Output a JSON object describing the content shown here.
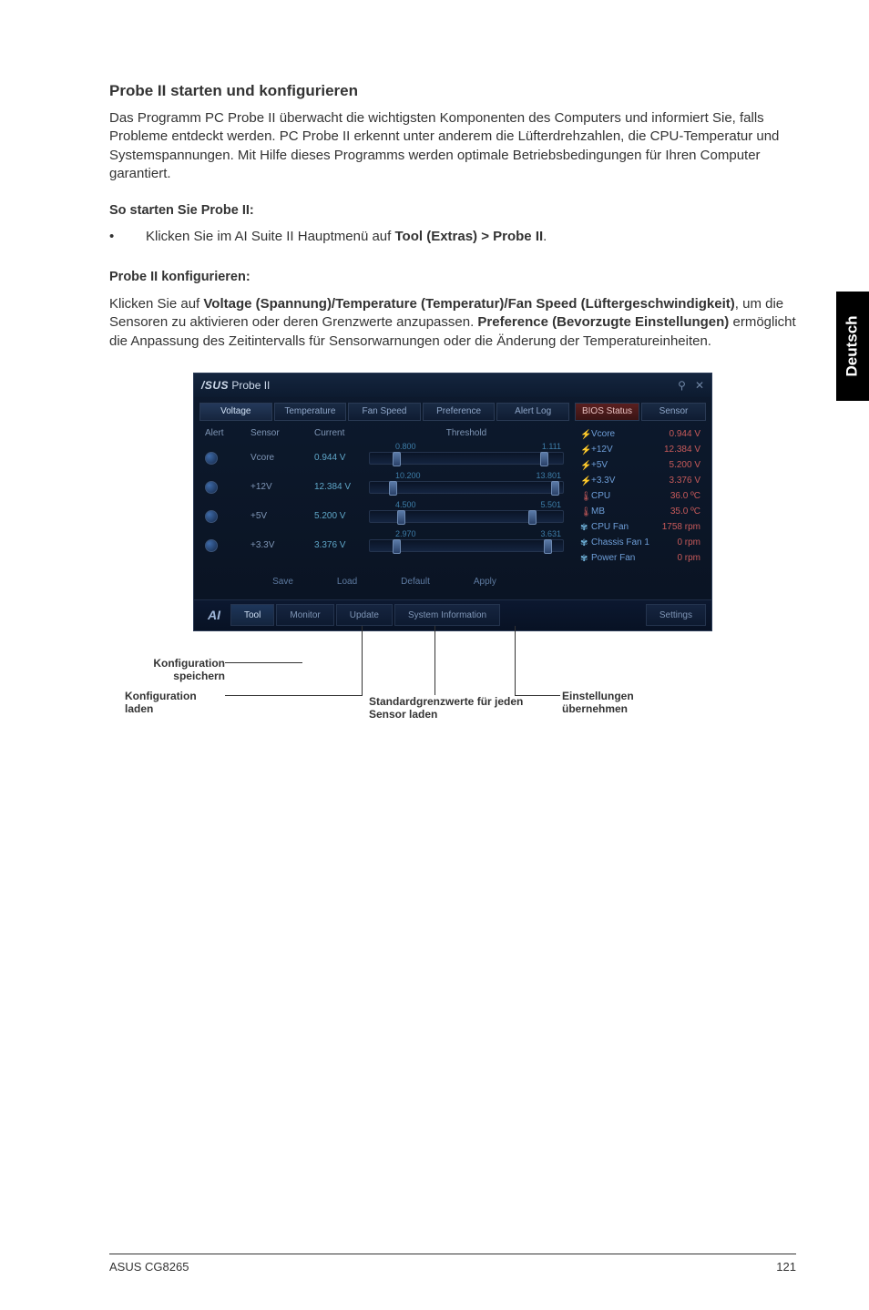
{
  "doc": {
    "heading": "Probe II starten und konfigurieren",
    "intro": "Das Programm PC Probe II überwacht die wichtigsten Komponenten des Computers und informiert Sie, falls Probleme entdeckt werden. PC Probe II erkennt unter anderem die Lüfterdrehzahlen, die CPU-Temperatur und Systemspannungen. Mit Hilfe dieses Programms werden optimale Betriebsbedingungen für Ihren Computer garantiert.",
    "start_head": "So starten Sie Probe II:",
    "bullet_pre": "Klicken Sie im AI Suite II Hauptmenü auf ",
    "bullet_bold": "Tool (Extras) > Probe II",
    "bullet_post": ".",
    "config_head": "Probe II konfigurieren:",
    "config_p1_pre": "Klicken Sie auf ",
    "config_p1_b1": "Voltage (Spannung)/Temperature (Temperatur)/Fan Speed (Lüftergeschwindigkeit)",
    "config_p1_mid": ", um die Sensoren zu aktivieren oder deren Grenzwerte anzupassen. ",
    "config_p1_b2": "Preference (Bevorzugte Einstellungen)",
    "config_p1_post": " ermöglicht die Anpassung des Zeitintervalls für Sensorwarnungen oder die Änderung der Temperatureinheiten.",
    "side_tab": "Deutsch",
    "footer_left": "ASUS CG8265",
    "footer_right": "121"
  },
  "anno": {
    "save": "Konfiguration speichern",
    "load": "Konfiguration laden",
    "default": "Standardgrenzwerte für jeden Sensor laden",
    "apply": "Einstellungen übernehmen"
  },
  "app": {
    "title_brand": "/SUS",
    "title_name": "Probe II",
    "win_min": "�ут",
    "win_close": "✕",
    "tabs": [
      "Voltage",
      "Temperature",
      "Fan Speed",
      "Preference",
      "Alert Log"
    ],
    "active_tab": 0,
    "cols": {
      "alert": "Alert",
      "sensor": "Sensor",
      "current": "Current",
      "threshold": "Threshold"
    },
    "rows": [
      {
        "sensor": "Vcore",
        "current": "0.944 V",
        "lo": "0.800",
        "hi": "1.111",
        "lop": 12,
        "hip": 88
      },
      {
        "sensor": "+12V",
        "current": "12.384 V",
        "lo": "10.200",
        "hi": "13.801",
        "lop": 10,
        "hip": 94
      },
      {
        "sensor": "+5V",
        "current": "5.200 V",
        "lo": "4.500",
        "hi": "5.501",
        "lop": 14,
        "hip": 82
      },
      {
        "sensor": "+3.3V",
        "current": "3.376 V",
        "lo": "2.970",
        "hi": "3.631",
        "lop": 12,
        "hip": 90
      }
    ],
    "bottom": {
      "save": "Save",
      "load": "Load",
      "default": "Default",
      "apply": "Apply"
    },
    "status_tabs": [
      "BIOS Status",
      "Sensor"
    ],
    "status_active": 0,
    "status": [
      {
        "icon": "volt",
        "name": "Vcore",
        "val": "0.944 V"
      },
      {
        "icon": "volt",
        "name": "+12V",
        "val": "12.384 V"
      },
      {
        "icon": "volt",
        "name": "+5V",
        "val": "5.200 V"
      },
      {
        "icon": "volt",
        "name": "+3.3V",
        "val": "3.376 V"
      },
      {
        "icon": "temp",
        "name": "CPU",
        "val": "36.0 ºC"
      },
      {
        "icon": "temp",
        "name": "MB",
        "val": "35.0 ºC"
      },
      {
        "icon": "fan",
        "name": "CPU Fan",
        "val": "1758 rpm"
      },
      {
        "icon": "fan",
        "name": "Chassis Fan 1",
        "val": "0 rpm"
      },
      {
        "icon": "fan",
        "name": "Power Fan",
        "val": "0 rpm"
      }
    ],
    "footer_btns": [
      "Tool",
      "Monitor",
      "Update",
      "System Information",
      "Settings"
    ]
  }
}
